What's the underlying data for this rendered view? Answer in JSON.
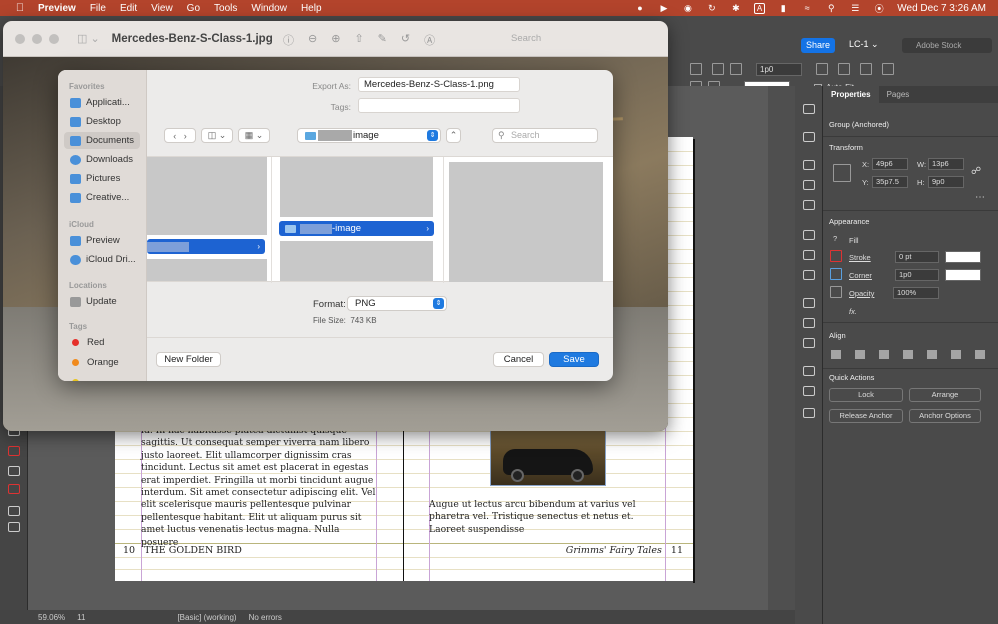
{
  "menubar": {
    "app_name": "Preview",
    "items": [
      "File",
      "Edit",
      "View",
      "Go",
      "Tools",
      "Window",
      "Help"
    ],
    "input_indicator": "A",
    "datetime": "Wed Dec 7  3:26 AM"
  },
  "indesign": {
    "share_label": "Share",
    "workspace": "LC-1",
    "stock_search_placeholder": "Adobe Stock",
    "top_field_1": "1p0",
    "autofit_label": "Auto-Fit",
    "status": {
      "zoom": "59.06%",
      "page": "11",
      "style": "[Basic] (working)",
      "preflight": "No errors"
    },
    "props": {
      "tab_properties": "Properties",
      "tab_pages": "Pages",
      "selection": "Group (Anchored)",
      "transform_head": "Transform",
      "x_label": "X:",
      "x_value": "49p6",
      "y_label": "Y:",
      "y_value": "35p7.5",
      "w_label": "W:",
      "w_value": "13p6",
      "h_label": "H:",
      "h_value": "9p0",
      "appearance_head": "Appearance",
      "fill_label": "Fill",
      "stroke_label": "Stroke",
      "stroke_value": "0 pt",
      "corner_label": "Corner",
      "corner_value": "1p0",
      "opacity_label": "Opacity",
      "opacity_value": "100%",
      "fx_label": "fx.",
      "align_head": "Align",
      "quick_head": "Quick Actions",
      "lock_btn": "Lock",
      "arrange_btn": "Arrange",
      "release_btn": "Release Anchor",
      "anchor_btn": "Anchor Options"
    },
    "page": {
      "left_text": "id. In hac habitasse platea dictumst quisque sagittis. Ut consequat semper viverra nam libero justo laoreet. Elit ullamcorper dignissim cras tincidunt. Lectus sit amet est placerat in egestas erat imperdiet. Fringilla ut morbi tincidunt augue interdum. Sit amet consectetur adipiscing elit. Vel elit scelerisque mauris pellentesque pulvinar pellentesque habitant. Elit ut aliquam purus sit amet luctus venenatis lectus magna. Nulla posuere",
      "right_text": "Augue ut lectus arcu bibendum at varius vel pharetra vel. Tristique senectus et netus et. Laoreet suspendisse",
      "footer_left_num": "10",
      "footer_left_title": "THE GOLDEN BIRD",
      "footer_right_title": "Grimms' Fairy Tales",
      "footer_right_num": "11"
    }
  },
  "preview": {
    "window_title": "Mercedes-Benz-S-Class-1.jpg",
    "search_placeholder": "Search"
  },
  "save_sheet": {
    "export_as_label": "Export As:",
    "export_as_value": "Mercedes-Benz-S-Class-1.png",
    "tags_label": "Tags:",
    "tags_value": "",
    "location_name": "image",
    "search_placeholder": "Search",
    "column_2_item": "-image",
    "format_label": "Format:",
    "format_value": "PNG",
    "file_size_label": "File Size:",
    "file_size_value": "743 KB",
    "new_folder": "New Folder",
    "cancel": "Cancel",
    "save": "Save",
    "sidebar": {
      "favorites_head": "Favorites",
      "favorites": [
        "Applicati...",
        "Desktop",
        "Documents",
        "Downloads",
        "Pictures",
        "Creative..."
      ],
      "icloud_head": "iCloud",
      "icloud": [
        "Preview",
        "iCloud Dri..."
      ],
      "locations_head": "Locations",
      "locations": [
        "Update"
      ],
      "tags_head": "Tags",
      "tags": [
        "Red",
        "Orange"
      ],
      "tag_colors": [
        "#e5302a",
        "#f08a1c",
        "#e8c31e"
      ]
    }
  }
}
